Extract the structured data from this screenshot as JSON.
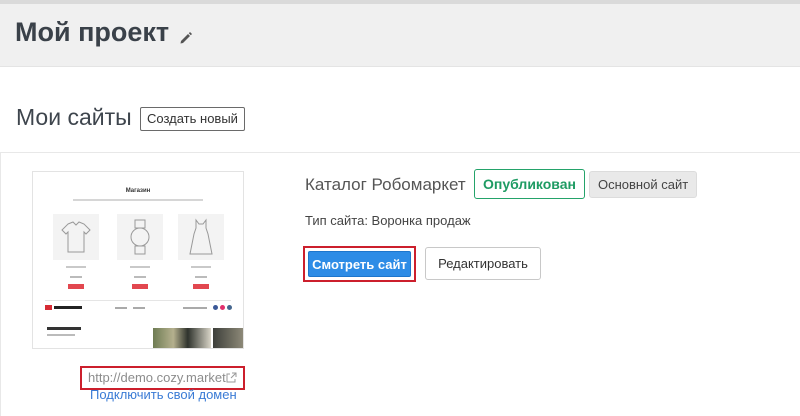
{
  "header": {
    "project_title": "Мой проект",
    "edit_icon": "pencil-icon"
  },
  "sites": {
    "heading": "Мои сайты",
    "create_label": "Создать новый"
  },
  "site": {
    "name": "Каталог Робомаркет",
    "status_badge": "Опубликован",
    "main_badge": "Основной сайт",
    "type_label": "Тип сайта:",
    "type_value": "Воронка продаж",
    "type_text": "Тип сайта:  Воронка продаж",
    "view_label": "Смотреть сайт",
    "edit_label": "Редактировать",
    "url": "http://demo.cozy.market",
    "url_icon": "external-link-icon",
    "connect_domain_label": "Подключить свой домен",
    "preview": {
      "title": "Магазин",
      "products": 3,
      "accent": "#e2474f",
      "logo_color": "#d62b34"
    }
  },
  "colors": {
    "primary": "#2d8ce6",
    "success": "#1e9b63",
    "highlight": "#cc1f2c",
    "link": "#3a7bd5"
  }
}
